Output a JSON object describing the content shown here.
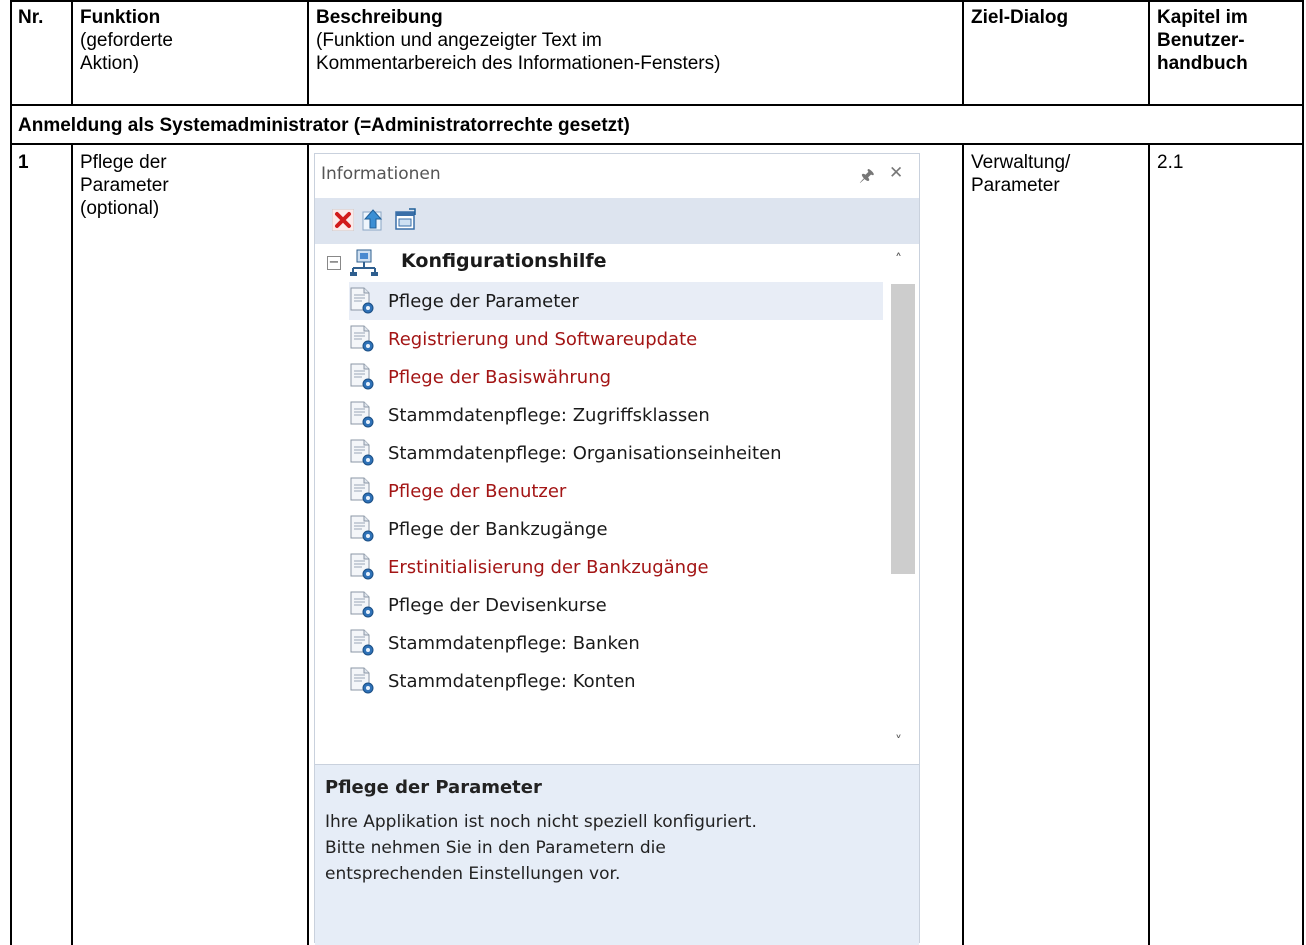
{
  "table": {
    "headers": {
      "nr": "Nr.",
      "funktion_title": "Funktion",
      "funktion_sub": [
        "(geforderte",
        "Aktion)"
      ],
      "beschreibung_title": "Beschreibung",
      "beschreibung_sub": [
        "(Funktion und angezeigter Text im",
        "Kommentarbereich des Informationen-Fensters)"
      ],
      "ziel": "Ziel-Dialog",
      "kapitel": [
        "Kapitel im",
        "Benutzer-",
        "handbuch"
      ]
    },
    "section_title": "Anmeldung als Systemadministrator (=Administratorrechte gesetzt)",
    "row": {
      "nr": "1",
      "funktion": [
        "Pflege der",
        "Parameter",
        "(optional)"
      ],
      "ziel": [
        "Verwaltung/",
        "Parameter"
      ],
      "kapitel": "2.1"
    }
  },
  "panel": {
    "title": "Informationen",
    "pin_icon": "pin-icon",
    "close_icon": "close-icon",
    "toolbar": [
      "delete-icon",
      "up-icon",
      "window-icon"
    ],
    "root_label": "Konfigurationshilfe",
    "items": [
      {
        "label": "Pflege der Parameter",
        "color": "#1a1a1a",
        "selected": true
      },
      {
        "label": "Registrierung und Softwareupdate",
        "color": "#a31515",
        "selected": false
      },
      {
        "label": "Pflege der Basiswährung",
        "color": "#a31515",
        "selected": false
      },
      {
        "label": "Stammdatenpflege: Zugriffsklassen",
        "color": "#1a1a1a",
        "selected": false
      },
      {
        "label": "Stammdatenpflege: Organisationseinheiten",
        "color": "#1a1a1a",
        "selected": false
      },
      {
        "label": "Pflege der Benutzer",
        "color": "#a31515",
        "selected": false
      },
      {
        "label": "Pflege der Bankzugänge",
        "color": "#1a1a1a",
        "selected": false
      },
      {
        "label": "Erstinitialisierung der Bankzugänge",
        "color": "#a31515",
        "selected": false
      },
      {
        "label": "Pflege der Devisenkurse",
        "color": "#1a1a1a",
        "selected": false
      },
      {
        "label": "Stammdatenpflege: Banken",
        "color": "#1a1a1a",
        "selected": false
      },
      {
        "label": "Stammdatenpflege: Konten",
        "color": "#1a1a1a",
        "selected": false
      }
    ],
    "description": {
      "title": "Pflege der Parameter",
      "lines": [
        "Ihre Applikation ist noch nicht speziell konfiguriert.",
        "Bitte nehmen Sie in den Parametern die",
        "entsprechenden Einstellungen vor."
      ]
    }
  }
}
